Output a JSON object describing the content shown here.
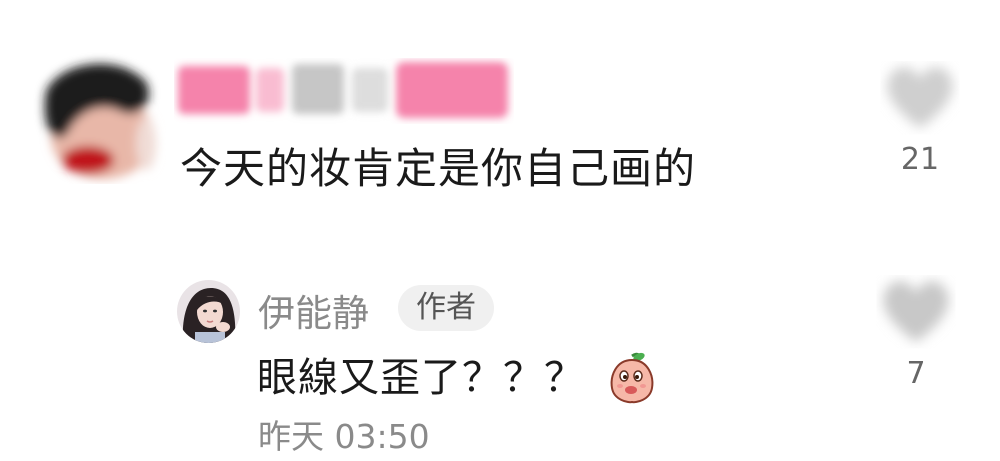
{
  "comment": {
    "text": "今天的妆肯定是你自己画的",
    "like_icon": "heart-icon",
    "like_count": "21"
  },
  "reply": {
    "author_name": "伊能静",
    "author_badge": "作者",
    "text": "眼線又歪了？？？",
    "sticker": "peach-sticker-icon",
    "timestamp": "昨天 03:50",
    "like_icon": "heart-icon",
    "like_count": "7"
  },
  "colors": {
    "name_blur_pink": "#f25a8f",
    "avatar_red": "#c0141e",
    "text_dark": "#1a1a1a",
    "text_gray": "#8a8a8a",
    "badge_bg": "#f0f0f0"
  }
}
